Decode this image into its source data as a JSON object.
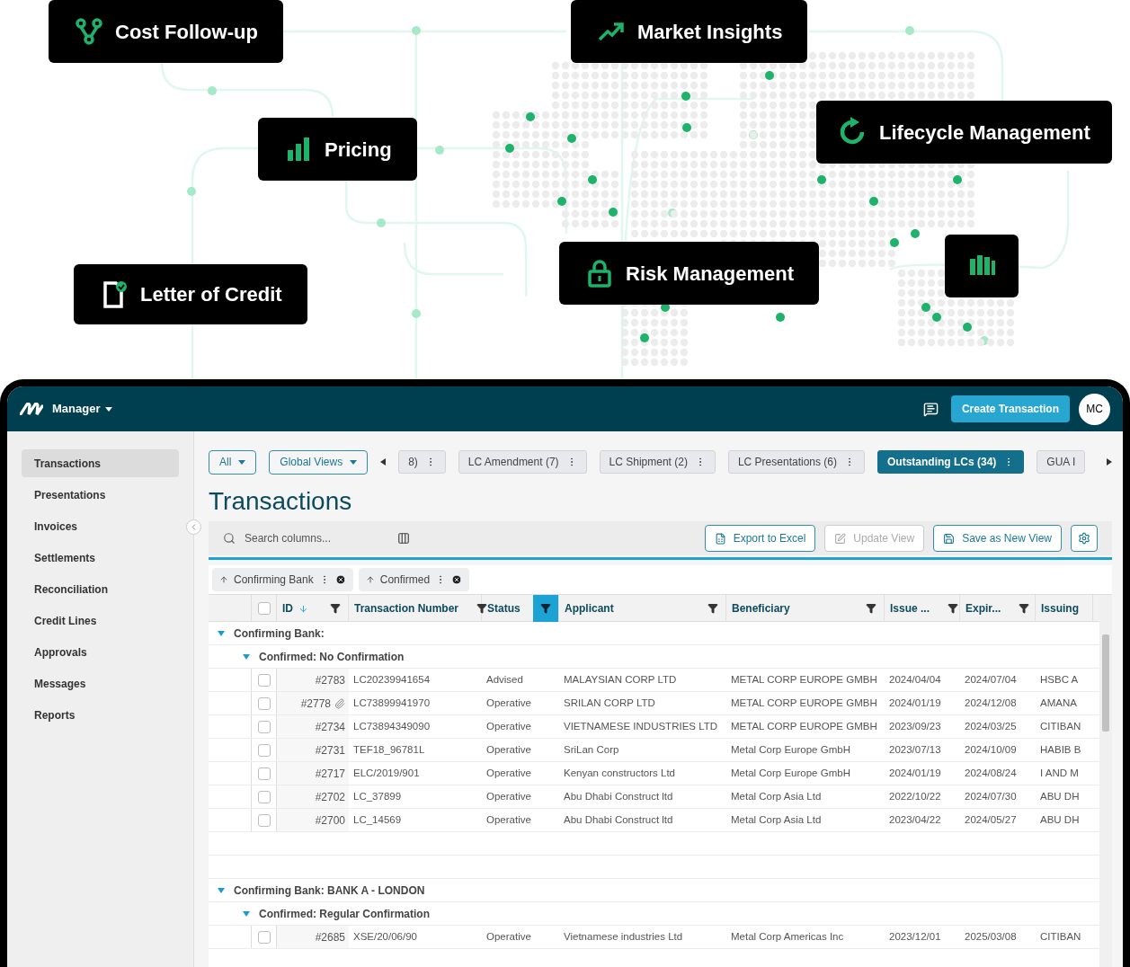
{
  "features": [
    {
      "kind": "branch",
      "label": "Cost Follow-up"
    },
    {
      "kind": "trend",
      "label": "Market Insights"
    },
    {
      "kind": "bars",
      "label": "Pricing"
    },
    {
      "kind": "cycle",
      "label": "Lifecycle Management"
    },
    {
      "kind": "document",
      "label": "Letter of Credit"
    },
    {
      "kind": "lock",
      "label": "Risk Management"
    },
    {
      "kind": "columns"
    }
  ],
  "app": {
    "menu": "Manager",
    "create_button": "Create Transaction",
    "avatar": "MC"
  },
  "sidebar": [
    {
      "label": "Transactions",
      "selected": true
    },
    {
      "label": "Presentations",
      "selected": false
    },
    {
      "label": "Invoices",
      "selected": false
    },
    {
      "label": "Settlements",
      "selected": false
    },
    {
      "label": "Reconciliation",
      "selected": false
    },
    {
      "label": "Credit Lines",
      "selected": false
    },
    {
      "label": "Approvals",
      "selected": false
    },
    {
      "label": "Messages",
      "selected": false
    },
    {
      "label": "Reports",
      "selected": false
    }
  ],
  "filters": [
    "All",
    "Global Views"
  ],
  "view_tabs": [
    {
      "label": "8)",
      "selected": false
    },
    {
      "label": "LC Amendment (7)",
      "selected": false
    },
    {
      "label": "LC Shipment (2)",
      "selected": false
    },
    {
      "label": "LC Presentations (6)",
      "selected": false
    },
    {
      "label": "Outstanding LCs (34)",
      "selected": true
    },
    {
      "label": "GUA I",
      "selected": false
    }
  ],
  "title": "Transactions",
  "select_all_checked": false,
  "search": {
    "placeholder": "Search columns..."
  },
  "actions": [
    {
      "label": "Export to Excel",
      "kind": "excel",
      "disabled": false
    },
    {
      "label": "Update View",
      "kind": "edit",
      "disabled": true
    },
    {
      "label": "Save as New View",
      "kind": "save",
      "disabled": false
    }
  ],
  "group_chips": [
    "Confirming Bank",
    "Confirmed"
  ],
  "columns": [
    {
      "label": "ID",
      "sorted": true,
      "filter_active": false
    },
    {
      "label": "Transaction Number",
      "sorted": false,
      "filter_active": false
    },
    {
      "label": "Status",
      "sorted": false,
      "filter_active": true
    },
    {
      "label": "Applicant",
      "sorted": false,
      "filter_active": false
    },
    {
      "label": "Beneficiary",
      "sorted": false,
      "filter_active": false
    },
    {
      "label": "Issue ...",
      "sorted": false,
      "filter_active": false
    },
    {
      "label": "Expir...",
      "sorted": false,
      "filter_active": false
    },
    {
      "label": "Issuing",
      "sorted": false
    }
  ],
  "groups": [
    {
      "label": "Confirming Bank:",
      "expanded": true,
      "children": [
        {
          "label": "Confirmed: No Confirmation",
          "expanded": true,
          "rows": [
            {
              "id": "#2783",
              "attachment": false,
              "checked": false,
              "cells": [
                "LC20239941654",
                "Advised",
                "MALAYSIAN CORP LTD",
                "METAL CORP EUROPE GMBH",
                "2024/04/04",
                "2024/07/04",
                "HSBC A"
              ]
            },
            {
              "id": "#2778",
              "attachment": true,
              "checked": false,
              "cells": [
                "LC73899941970",
                "Operative",
                "SRILAN CORP LTD",
                "METAL CORP EUROPE GMBH",
                "2024/01/19",
                "2024/12/08",
                "AMANA"
              ]
            },
            {
              "id": "#2734",
              "attachment": false,
              "checked": false,
              "cells": [
                "LC73894349090",
                "Operative",
                "VIETNAMESE INDUSTRIES LTD",
                "METAL CORP EUROPE GMBH",
                "2023/09/23",
                "2024/03/25",
                "CITIBAN"
              ]
            },
            {
              "id": "#2731",
              "attachment": false,
              "checked": false,
              "cells": [
                "TEF18_96781L",
                "Operative",
                "SriLan Corp",
                "Metal Corp Europe GmbH",
                "2023/07/13",
                "2024/10/09",
                "HABIB B"
              ]
            },
            {
              "id": "#2717",
              "attachment": false,
              "checked": false,
              "cells": [
                "ELC/2019/901",
                "Operative",
                "Kenyan constructors Ltd",
                "Metal Corp Europe GmbH",
                "2024/01/19",
                "2024/08/24",
                "I AND M"
              ]
            },
            {
              "id": "#2702",
              "attachment": false,
              "checked": false,
              "cells": [
                "LC_37899",
                "Operative",
                "Abu Dhabi Construct ltd",
                "Metal Corp Asia Ltd",
                "2022/10/22",
                "2024/07/30",
                "ABU DH"
              ]
            },
            {
              "id": "#2700",
              "attachment": false,
              "checked": false,
              "cells": [
                "LC_14569",
                "Operative",
                "Abu Dhabi Construct ltd",
                "Metal Corp Asia Ltd",
                "2023/04/22",
                "2024/05/27",
                "ABU DH"
              ]
            }
          ]
        }
      ]
    },
    {
      "label": "Confirming Bank: BANK A - LONDON",
      "expanded": true,
      "children": [
        {
          "label": "Confirmed: Regular Confirmation",
          "expanded": true,
          "rows": [
            {
              "id": "#2685",
              "attachment": false,
              "checked": false,
              "cells": [
                "XSE/20/06/90",
                "Operative",
                "Vietnamese industries Ltd",
                "Metal Corp Americas Inc",
                "2023/12/01",
                "2025/03/08",
                "CITIBAN"
              ]
            }
          ]
        }
      ]
    }
  ]
}
